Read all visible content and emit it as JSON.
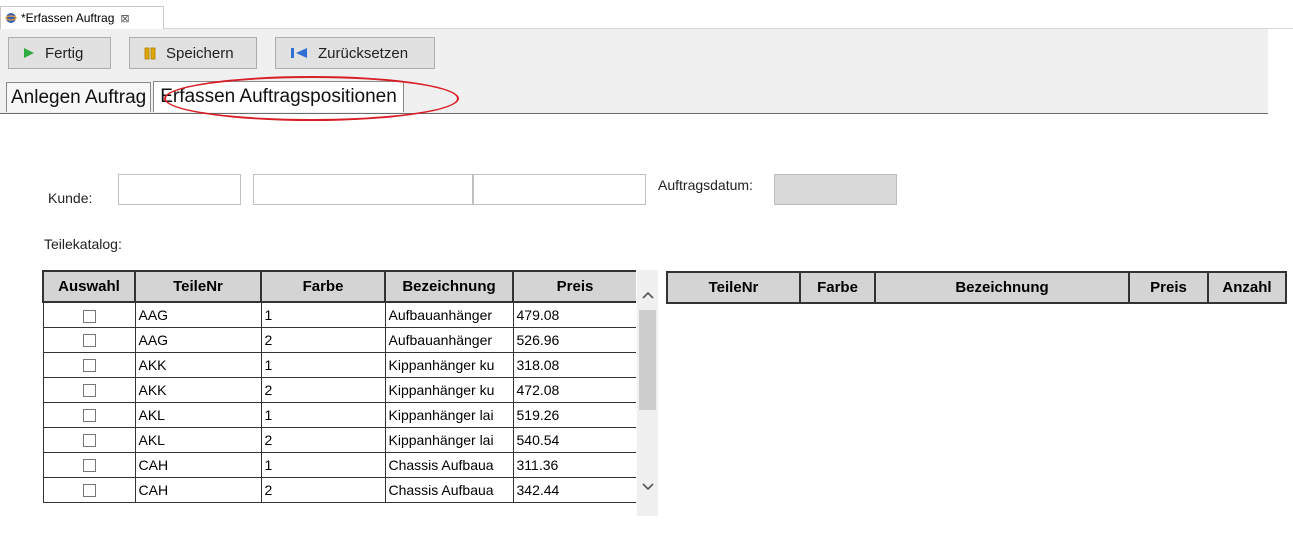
{
  "editor_tab": {
    "title": "*Erfassen Auftrag",
    "close": "⊠"
  },
  "toolbar": {
    "fertig": "Fertig",
    "speichern": "Speichern",
    "zuruecksetzen": "Zurücksetzen"
  },
  "tabs": {
    "anlegen": "Anlegen Auftrag",
    "erfassen": "Erfassen Auftragspositionen"
  },
  "form": {
    "kunde_label": "Kunde:",
    "kunde_nr": "",
    "kunde_name": "",
    "kunde_extra": "",
    "auftragsdatum_label": "Auftragsdatum:",
    "auftragsdatum_value": "",
    "teilekatalog_label": "Teilekatalog:"
  },
  "catalog": {
    "headers": [
      "Auswahl",
      "TeileNr",
      "Farbe",
      "Bezeichnung",
      "Preis"
    ],
    "rows": [
      {
        "teilenr": "AAG",
        "farbe": "1",
        "bezeichnung": "Aufbauanhänger",
        "preis": "479.08"
      },
      {
        "teilenr": "AAG",
        "farbe": "2",
        "bezeichnung": "Aufbauanhänger",
        "preis": "526.96"
      },
      {
        "teilenr": "AKK",
        "farbe": "1",
        "bezeichnung": "Kippanhänger ku",
        "preis": "318.08"
      },
      {
        "teilenr": "AKK",
        "farbe": "2",
        "bezeichnung": "Kippanhänger ku",
        "preis": "472.08"
      },
      {
        "teilenr": "AKL",
        "farbe": "1",
        "bezeichnung": "Kippanhänger lai",
        "preis": "519.26"
      },
      {
        "teilenr": "AKL",
        "farbe": "2",
        "bezeichnung": "Kippanhänger lai",
        "preis": "540.54"
      },
      {
        "teilenr": "CAH",
        "farbe": "1",
        "bezeichnung": "Chassis Aufbaua",
        "preis": "311.36"
      },
      {
        "teilenr": "CAH",
        "farbe": "2",
        "bezeichnung": "Chassis Aufbaua",
        "preis": "342.44"
      }
    ]
  },
  "selection": {
    "headers": [
      "TeileNr",
      "Farbe",
      "Bezeichnung",
      "Preis",
      "Anzahl"
    ]
  },
  "colors": {
    "annotation": "#d81f26",
    "header_bg": "#d4d4d4",
    "disabled_field": "#d9d9d9",
    "play_icon": "#2faa3f",
    "pause_icon": "#e0a800",
    "rewind_icon": "#2f6fd6"
  }
}
